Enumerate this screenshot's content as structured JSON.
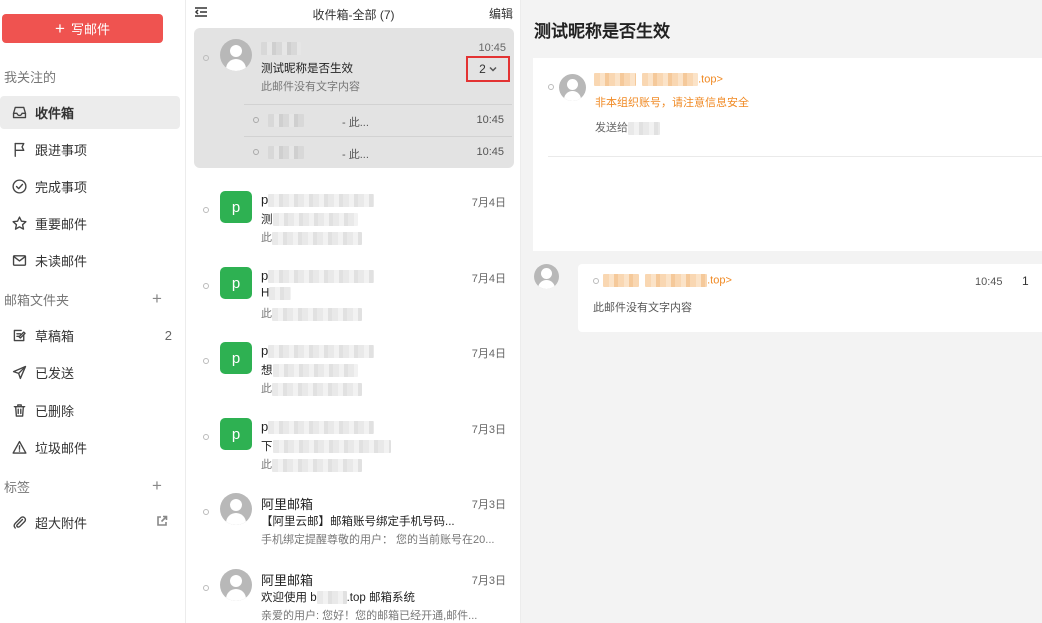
{
  "sidebar": {
    "compose_label": "写邮件",
    "followed_title": "我关注的",
    "nav": [
      {
        "label": "收件箱",
        "icon": "inbox-icon"
      },
      {
        "label": "跟进事项",
        "icon": "flag-icon"
      },
      {
        "label": "完成事项",
        "icon": "check-circle-icon"
      },
      {
        "label": "重要邮件",
        "icon": "star-icon"
      },
      {
        "label": "未读邮件",
        "icon": "envelope-icon"
      }
    ],
    "folders_title": "邮箱文件夹",
    "folders": [
      {
        "label": "草稿箱",
        "icon": "draft-icon",
        "count": "2"
      },
      {
        "label": "已发送",
        "icon": "send-icon"
      },
      {
        "label": "已删除",
        "icon": "trash-icon"
      },
      {
        "label": "垃圾邮件",
        "icon": "warning-icon"
      }
    ],
    "tags_title": "标签",
    "attachment_label": "超大附件"
  },
  "list": {
    "title": "收件箱-全部 (7)",
    "edit_label": "编辑",
    "selected": {
      "time": "10:45",
      "subject": "测试昵称是否生效",
      "preview": "此邮件没有文字内容",
      "thread_count": "2",
      "sub_rows": [
        {
          "text": "- 此...",
          "time": "10:45"
        },
        {
          "text": "- 此...",
          "time": "10:45"
        }
      ]
    },
    "mails": [
      {
        "avatar": "p",
        "sender": "p",
        "subject": "测",
        "preview": "此",
        "time": "7月4日"
      },
      {
        "avatar": "p",
        "sender": "p",
        "subject": "H",
        "preview": "此",
        "time": "7月4日"
      },
      {
        "avatar": "p",
        "sender": "p",
        "subject": "想",
        "preview": "此",
        "time": "7月4日"
      },
      {
        "avatar": "p",
        "sender": "p",
        "subject": "下",
        "preview": "此",
        "time": "7月3日"
      },
      {
        "sender": "阿里邮箱",
        "subject": "【阿里云邮】邮箱账号绑定手机号码...",
        "preview": "手机绑定提醒尊敬的用户：  您的当前账号在20...",
        "time": "7月3日"
      },
      {
        "sender": "阿里邮箱",
        "subject_prefix": "欢迎使用 b",
        "subject_suffix": ".top 邮箱系统",
        "preview": "亲爱的用户:    您好！您的邮箱已经开通,邮件...",
        "time": "7月3日"
      }
    ]
  },
  "reader": {
    "title": "测试昵称是否生效",
    "from_suffix": ".top>",
    "warning": "非本组织账号，请注意信息安全",
    "to_label": "发送给",
    "reply": {
      "from_suffix": ".top>",
      "time": "10:45",
      "index": "1",
      "body": "此邮件没有文字内容"
    }
  },
  "colors": {
    "accent": "#ef5350",
    "warning_text": "#f08a24",
    "avatar_green": "#2eb152",
    "highlight_box": "#e33333"
  }
}
